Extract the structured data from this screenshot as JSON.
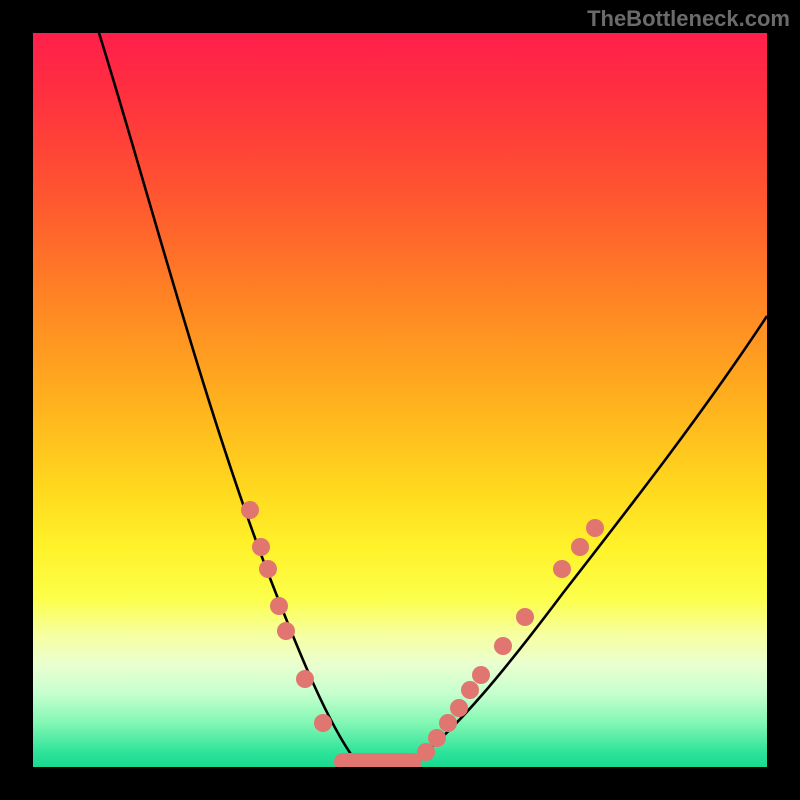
{
  "watermark": "TheBottleneck.com",
  "chart_data": {
    "type": "line",
    "title": "",
    "xlabel": "",
    "ylabel": "",
    "xlim": [
      0,
      100
    ],
    "ylim": [
      0,
      100
    ],
    "grid": false,
    "legend": false,
    "background": "red-yellow-green vertical gradient",
    "series": [
      {
        "name": "left-branch",
        "color": "#000000",
        "x": [
          9,
          12,
          15,
          18,
          21,
          24,
          27,
          30,
          32,
          34,
          36,
          38,
          40,
          42,
          44
        ],
        "y": [
          100,
          90,
          80,
          70,
          60,
          50,
          41,
          33,
          26,
          20,
          14,
          9,
          5,
          2,
          0
        ]
      },
      {
        "name": "valley-floor",
        "color": "#000000",
        "x": [
          44,
          46,
          48,
          50,
          52
        ],
        "y": [
          0,
          0,
          0,
          0,
          0
        ]
      },
      {
        "name": "right-branch",
        "color": "#000000",
        "x": [
          52,
          55,
          58,
          62,
          66,
          71,
          77,
          84,
          92,
          100
        ],
        "y": [
          0,
          3,
          7,
          12,
          18,
          25,
          33,
          42,
          52,
          62
        ]
      }
    ],
    "markers": [
      {
        "name": "left-cluster-dots",
        "color": "#e0766f",
        "points": [
          {
            "x": 29.5,
            "y": 35
          },
          {
            "x": 31,
            "y": 30
          },
          {
            "x": 32,
            "y": 27
          },
          {
            "x": 33.5,
            "y": 22
          },
          {
            "x": 34.5,
            "y": 18.5
          },
          {
            "x": 37,
            "y": 12
          },
          {
            "x": 39.5,
            "y": 6
          }
        ]
      },
      {
        "name": "valley-bar",
        "color": "#e0766f",
        "shape": "rounded-bar",
        "x_range": [
          41,
          53
        ],
        "y": 0
      },
      {
        "name": "right-cluster-dots",
        "color": "#e0766f",
        "points": [
          {
            "x": 53.5,
            "y": 2
          },
          {
            "x": 55,
            "y": 4
          },
          {
            "x": 56.5,
            "y": 6
          },
          {
            "x": 58,
            "y": 8
          },
          {
            "x": 59.5,
            "y": 10.5
          },
          {
            "x": 61,
            "y": 12.5
          },
          {
            "x": 64,
            "y": 16.5
          },
          {
            "x": 67,
            "y": 20.5
          },
          {
            "x": 72,
            "y": 27
          },
          {
            "x": 74.5,
            "y": 30
          },
          {
            "x": 76.5,
            "y": 32.5
          }
        ]
      }
    ],
    "colors": {
      "curve": "#000000",
      "markers": "#e0766f",
      "frame": "#000000",
      "gradient_top": "#ff1f4b",
      "gradient_mid": "#ffe62a",
      "gradient_bottom": "#19d98f"
    }
  }
}
